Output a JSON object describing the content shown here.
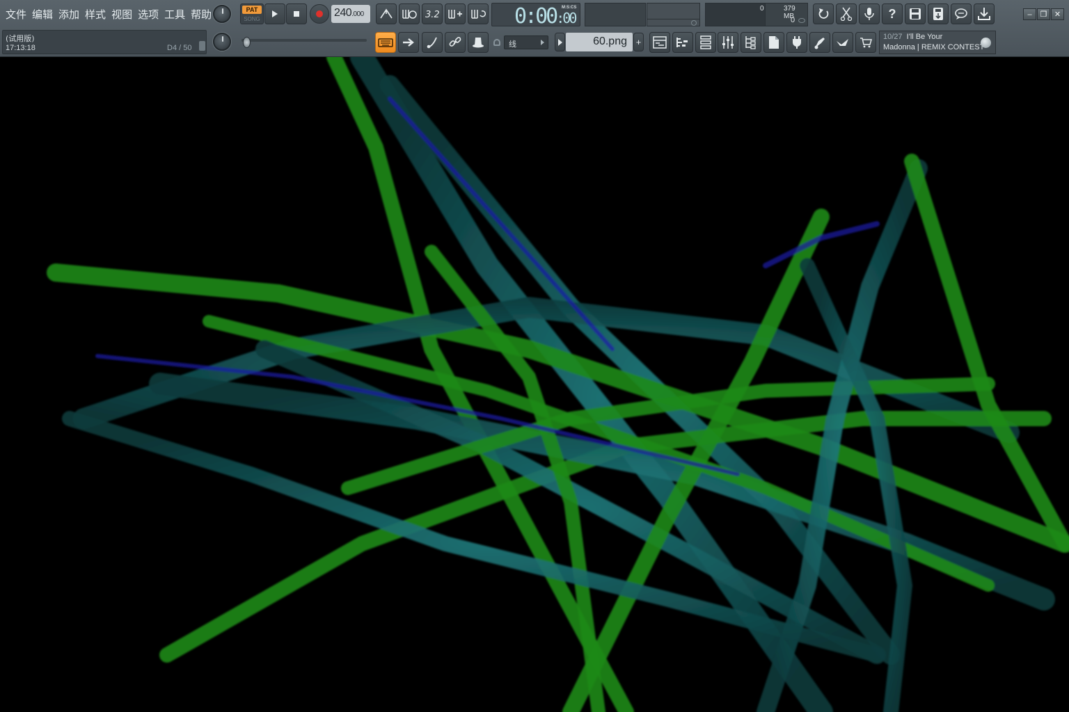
{
  "menu": [
    "文件",
    "编辑",
    "添加",
    "样式",
    "视图",
    "选项",
    "工具",
    "帮助"
  ],
  "hint": {
    "trial": "(试用版)",
    "time": "17:13:18",
    "notes": "D4 / 50"
  },
  "transport": {
    "pat": "PAT",
    "song": "SONG",
    "tempo_int": "240",
    "tempo_dec": ".000",
    "time_main": "0:00",
    "time_cs": ":00",
    "time_unit": "M:S:CS"
  },
  "meters": {
    "cpu": "0",
    "memory": "379 MB",
    "polyphony": "0"
  },
  "snap": {
    "value": "线"
  },
  "file": {
    "name": "60.png"
  },
  "news": {
    "date": "10/27",
    "title": "I'll Be Your",
    "subtitle": "Madonna | REMIX CONTEST"
  },
  "colors": {
    "accent": "#f19a3a",
    "record": "#e0312b",
    "viz_green": "#1f8a1a",
    "viz_teal": "#1b6e72",
    "viz_blue": "#1a1aa8"
  },
  "icons": [
    "metronome-icon",
    "wait-record-icon",
    "countdown-icon",
    "step-edit-icon",
    "loop-record-icon",
    "typing-keyboard-icon",
    "arrow-icon",
    "blend-notes-icon",
    "link-icon",
    "hat-icon",
    "playlist-icon",
    "piano-roll-icon",
    "channel-rack-icon",
    "mixer-icon",
    "browser-icon",
    "project-icon",
    "plugin-icon",
    "touch-controller-icon",
    "export-icon",
    "shop-icon",
    "undo-icon",
    "cut-icon",
    "mic-icon",
    "help-icon",
    "save-icon",
    "render-icon",
    "chat-icon",
    "download-icon"
  ]
}
